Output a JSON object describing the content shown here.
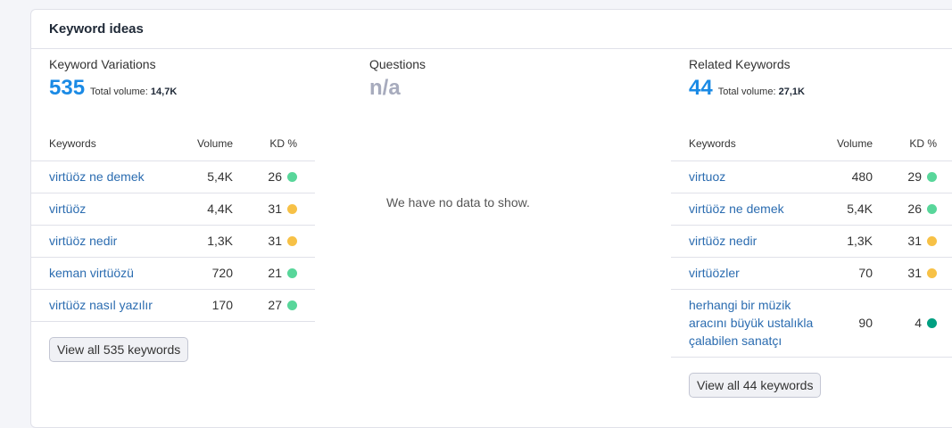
{
  "card": {
    "title": "Keyword ideas"
  },
  "variations": {
    "title": "Keyword Variations",
    "count": "535",
    "total_label": "Total volume:",
    "total_value": "14,7K",
    "headers": {
      "keywords": "Keywords",
      "volume": "Volume",
      "kd": "KD %"
    },
    "rows": [
      {
        "keyword": "virtüöz ne demek",
        "volume": "5,4K",
        "kd": "26",
        "color": "#58d69a"
      },
      {
        "keyword": "virtüöz",
        "volume": "4,4K",
        "kd": "31",
        "color": "#f7c146"
      },
      {
        "keyword": "virtüöz nedir",
        "volume": "1,3K",
        "kd": "31",
        "color": "#f7c146"
      },
      {
        "keyword": "keman virtüözü",
        "volume": "720",
        "kd": "21",
        "color": "#58d69a"
      },
      {
        "keyword": "virtüöz nasıl yazılır",
        "volume": "170",
        "kd": "27",
        "color": "#58d69a"
      }
    ],
    "view_all": "View all 535 keywords"
  },
  "questions": {
    "title": "Questions",
    "count": "n/a",
    "empty": "We have no data to show."
  },
  "related": {
    "title": "Related Keywords",
    "count": "44",
    "total_label": "Total volume:",
    "total_value": "27,1K",
    "headers": {
      "keywords": "Keywords",
      "volume": "Volume",
      "kd": "KD %"
    },
    "rows": [
      {
        "keyword": "virtuoz",
        "volume": "480",
        "kd": "29",
        "color": "#58d69a"
      },
      {
        "keyword": "virtüöz ne demek",
        "volume": "5,4K",
        "kd": "26",
        "color": "#58d69a"
      },
      {
        "keyword": "virtüöz nedir",
        "volume": "1,3K",
        "kd": "31",
        "color": "#f7c146"
      },
      {
        "keyword": "virtüözler",
        "volume": "70",
        "kd": "31",
        "color": "#f7c146"
      },
      {
        "keyword": "herhangi bir müzik aracını büyük ustalıkla çalabilen sanatçı",
        "volume": "90",
        "kd": "4",
        "color": "#009f81"
      }
    ],
    "view_all": "View all 44 keywords"
  }
}
